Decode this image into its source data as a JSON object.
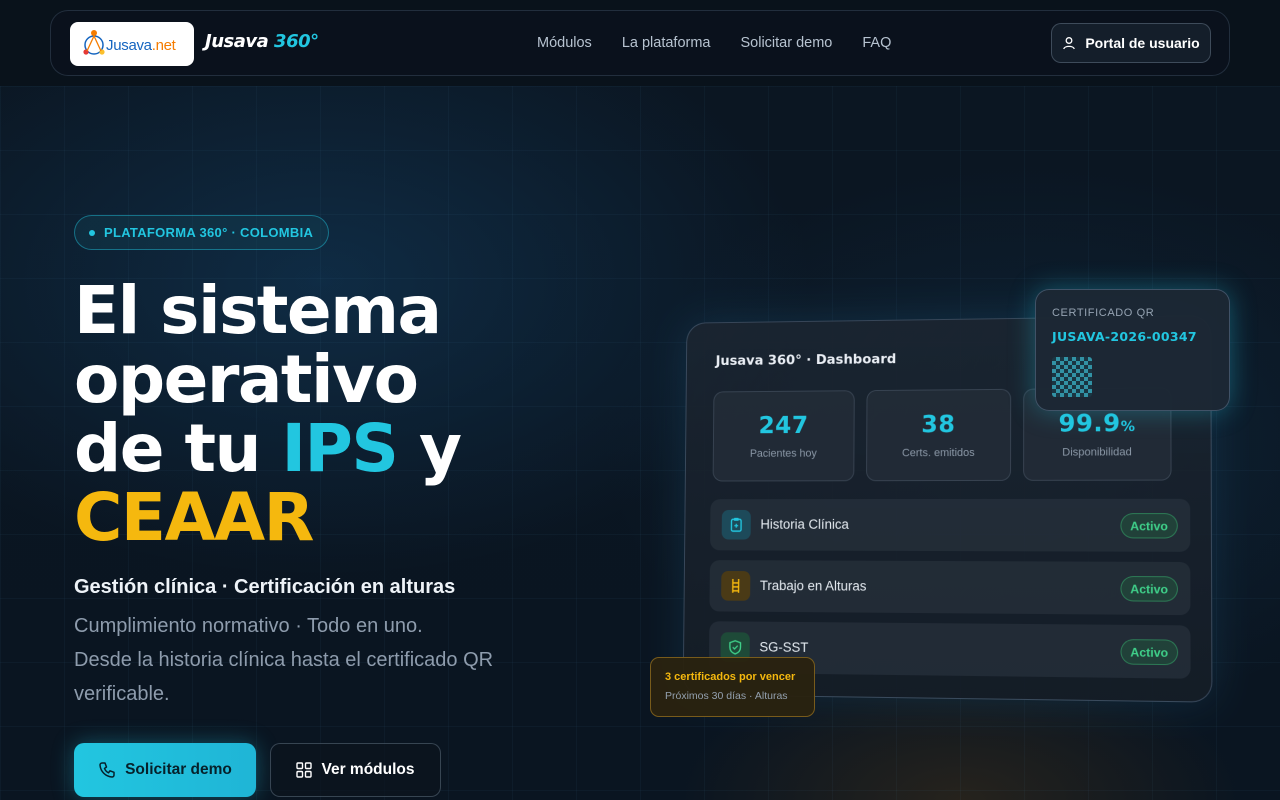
{
  "nav": {
    "logo_text_main": "Jusava",
    "logo_text_suffix": ".net",
    "brand_name": "Jusava",
    "brand_suffix": "360°",
    "links": [
      "Módulos",
      "La plataforma",
      "Solicitar demo",
      "FAQ"
    ],
    "portal_button": "Portal de usuario"
  },
  "hero": {
    "badge": "PLATAFORMA 360° · COLOMBIA",
    "headline_line1": "El sistema",
    "headline_line2": "operativo",
    "headline_line3_a": "de tu ",
    "headline_line3_ips": "IPS",
    "headline_line3_b": " y",
    "headline_line4": "CEAAR",
    "subtitle_bold": "Gestión clínica · Certificación en alturas",
    "subtitle_line2": "Cumplimiento normativo · Todo en uno.",
    "subtitle_line3": "Desde la historia clínica hasta el certificado QR verificable.",
    "cta_primary": "Solicitar demo",
    "cta_secondary": "Ver módulos"
  },
  "dashboard": {
    "title": "Jusava 360° · Dashboard",
    "stats": [
      {
        "value": "247",
        "unit": "",
        "label": "Pacientes hoy"
      },
      {
        "value": "38",
        "unit": "",
        "label": "Certs. emitidos"
      },
      {
        "value": "99.9",
        "unit": "%",
        "label": "Disponibilidad"
      }
    ],
    "modules": [
      {
        "label": "Historia Clínica",
        "status": "Activo",
        "icon": "clipboard-icon"
      },
      {
        "label": "Trabajo en Alturas",
        "status": "Activo",
        "icon": "ladder-icon"
      },
      {
        "label": "SG-SST",
        "status": "Activo",
        "icon": "shield-icon"
      }
    ]
  },
  "qr_card": {
    "label": "CERTIFICADO QR",
    "code": "JUSAVA-2026-00347"
  },
  "warning_card": {
    "title": "3 certificados por vencer",
    "subtitle": "Próximos 30 días · Alturas"
  },
  "colors": {
    "accent": "#22c6e0",
    "highlight": "#f5b80e",
    "background": "#0a1420",
    "success": "#3fd18a"
  }
}
